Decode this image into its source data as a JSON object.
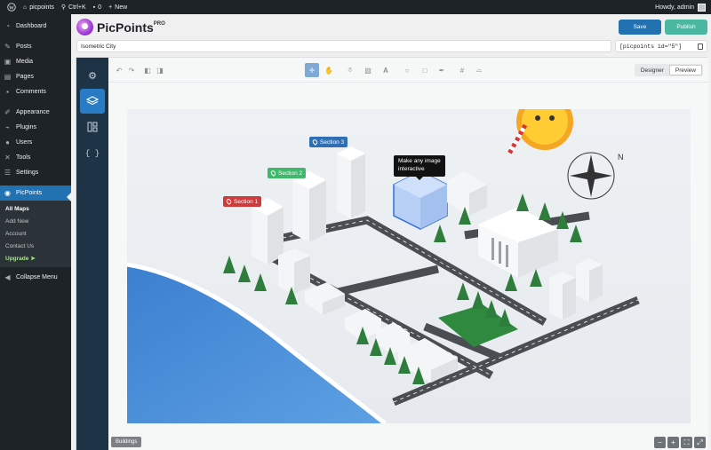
{
  "adminbar": {
    "site_name": "picpoints",
    "shortcut": "Ctrl+K",
    "comments_count": "0",
    "new_label": "New",
    "greeting": "Howdy, admin"
  },
  "sidebar": {
    "items": [
      {
        "label": "Dashboard",
        "icon": "dashboard-icon"
      },
      {
        "label": "Posts",
        "icon": "pin-icon"
      },
      {
        "label": "Media",
        "icon": "media-icon"
      },
      {
        "label": "Pages",
        "icon": "pages-icon"
      },
      {
        "label": "Comments",
        "icon": "comments-icon"
      },
      {
        "label": "Appearance",
        "icon": "brush-icon"
      },
      {
        "label": "Plugins",
        "icon": "plug-icon"
      },
      {
        "label": "Users",
        "icon": "users-icon"
      },
      {
        "label": "Tools",
        "icon": "wrench-icon"
      },
      {
        "label": "Settings",
        "icon": "settings-icon"
      },
      {
        "label": "PicPoints",
        "icon": "location-icon"
      }
    ],
    "submenu": [
      "All Maps",
      "Add New",
      "Account",
      "Contact Us",
      "Upgrade"
    ],
    "collapse_label": "Collapse Menu"
  },
  "header": {
    "brand": "PicPoints",
    "brand_badge": "PRO",
    "save_label": "Save",
    "publish_label": "Publish",
    "title_value": "Isometric City",
    "shortcode": "[picpoints id=\"5\"]"
  },
  "toolbar": {
    "designer_label": "Designer",
    "preview_label": "Preview"
  },
  "map": {
    "markers": [
      {
        "label": "Section 1",
        "color": "#cf3a3a"
      },
      {
        "label": "Section 2",
        "color": "#3fb86b"
      },
      {
        "label": "Section 3",
        "color": "#2f6fb5"
      }
    ],
    "tooltip_line1": "Make any image",
    "tooltip_line2": "interactive",
    "layer_label": "Buildings"
  },
  "colors": {
    "wp_dark": "#1d2327",
    "wp_blue": "#2271b1",
    "rail": "#1e3346",
    "publish": "#4ab7a0"
  }
}
